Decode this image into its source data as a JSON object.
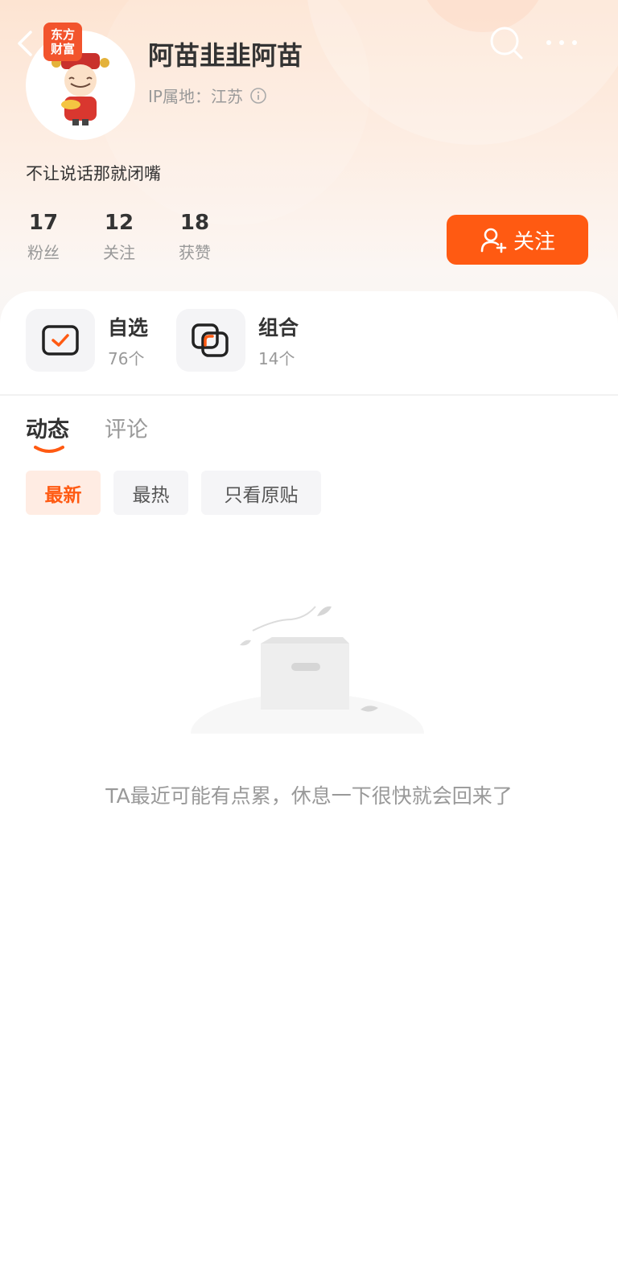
{
  "header": {
    "brand_badge_line1": "东方",
    "brand_badge_line2": "财富",
    "user_name": "阿苗韭韭阿苗",
    "ip_label": "IP属地：",
    "ip_value": "江苏",
    "bio": "不让说话那就闭嘴"
  },
  "stats": [
    {
      "value": "17",
      "label": "粉丝"
    },
    {
      "value": "12",
      "label": "关注"
    },
    {
      "value": "18",
      "label": "获赞"
    }
  ],
  "follow_button": {
    "label": "关注"
  },
  "entries": [
    {
      "title": "自选",
      "count": "76个"
    },
    {
      "title": "组合",
      "count": "14个"
    }
  ],
  "tabs": [
    {
      "label": "动态",
      "active": true
    },
    {
      "label": "评论",
      "active": false
    }
  ],
  "filters": [
    {
      "label": "最新",
      "active": true
    },
    {
      "label": "最热",
      "active": false
    },
    {
      "label": "只看原贴",
      "active": false
    }
  ],
  "empty_state": {
    "message": "TA最近可能有点累，休息一下很快就会回来了"
  },
  "colors": {
    "accent": "#ff5a12",
    "accent_light": "#ffece3",
    "muted": "#999999"
  }
}
